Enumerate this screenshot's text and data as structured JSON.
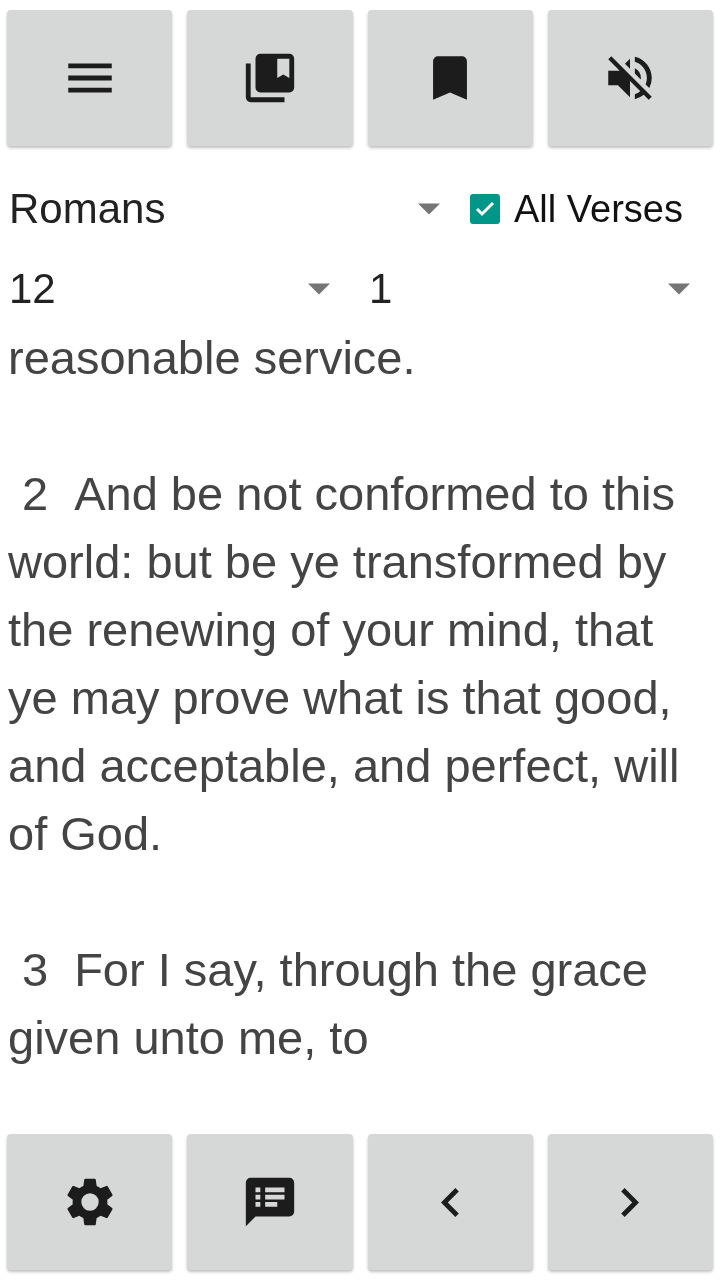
{
  "top_toolbar": [
    {
      "kind": "menu"
    },
    {
      "kind": "library"
    },
    {
      "kind": "bookmark"
    },
    {
      "kind": "mute"
    }
  ],
  "book_picker": {
    "value": "Romans"
  },
  "all_verses": {
    "label": "All Verses",
    "checked": true
  },
  "chapter_picker": {
    "value": "12"
  },
  "verse_picker": {
    "value": "1"
  },
  "verses": [
    {
      "text": "reasonable service."
    },
    {
      "number": "2",
      "text": "And be not conformed to this world: but be ye transformed by the renewing of your mind, that ye may prove what is that good, and acceptable, and perfect, will of God."
    },
    {
      "number": "3",
      "text": "For I say, through the grace given unto me, to"
    }
  ],
  "bottom_toolbar": [
    {
      "kind": "settings"
    },
    {
      "kind": "notes"
    },
    {
      "kind": "previous"
    },
    {
      "kind": "next"
    }
  ]
}
